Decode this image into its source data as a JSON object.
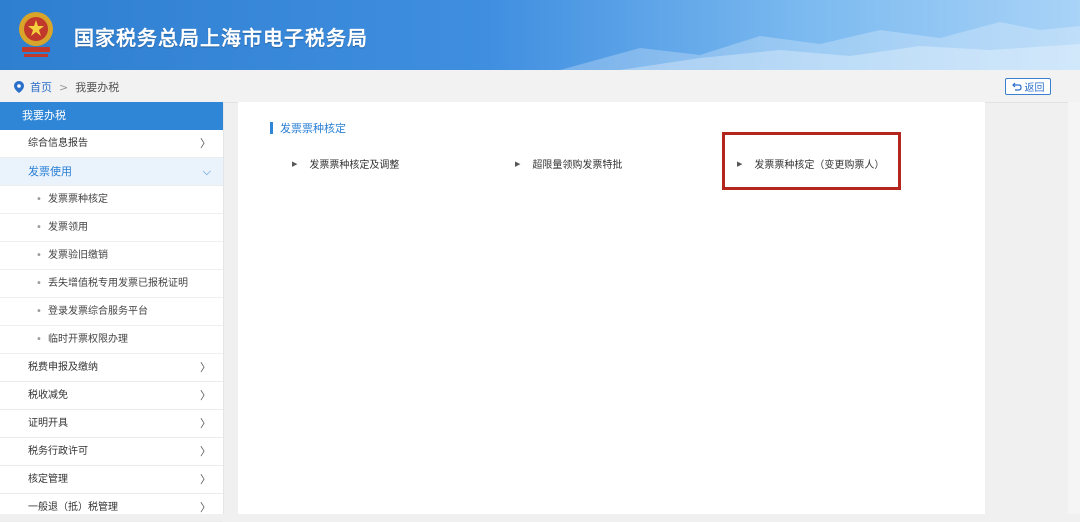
{
  "header": {
    "title": "国家税务总局上海市电子税务局"
  },
  "breadcrumb": {
    "home": "首页",
    "separator": ">",
    "current": "我要办税"
  },
  "toolbar": {
    "back_label": "返回"
  },
  "sidebar": {
    "heading": "我要办税",
    "items": [
      {
        "label": "综合信息报告",
        "arrow": "〉"
      },
      {
        "label": "发票使用",
        "arrow": "⌵"
      }
    ],
    "sub_items": [
      {
        "label": "发票票种核定"
      },
      {
        "label": "发票领用"
      },
      {
        "label": "发票验旧缴销"
      },
      {
        "label": "丢失增值税专用发票已报税证明"
      },
      {
        "label": "登录发票综合服务平台"
      },
      {
        "label": "临时开票权限办理"
      }
    ],
    "more_items": [
      {
        "label": "税费申报及缴纳",
        "arrow": "〉"
      },
      {
        "label": "税收减免",
        "arrow": "〉"
      },
      {
        "label": "证明开具",
        "arrow": "〉"
      },
      {
        "label": "税务行政许可",
        "arrow": "〉"
      },
      {
        "label": "核定管理",
        "arrow": "〉"
      },
      {
        "label": "一般退（抵）税管理",
        "arrow": "〉"
      }
    ]
  },
  "main": {
    "section_title": "发票票种核定",
    "links": [
      {
        "label": "发票票种核定及调整"
      },
      {
        "label": "超限量领购发票特批"
      },
      {
        "label": "发票票种核定（变更购票人）"
      }
    ]
  },
  "colors": {
    "accent": "#2f86d6",
    "highlight": "#b3261e"
  }
}
